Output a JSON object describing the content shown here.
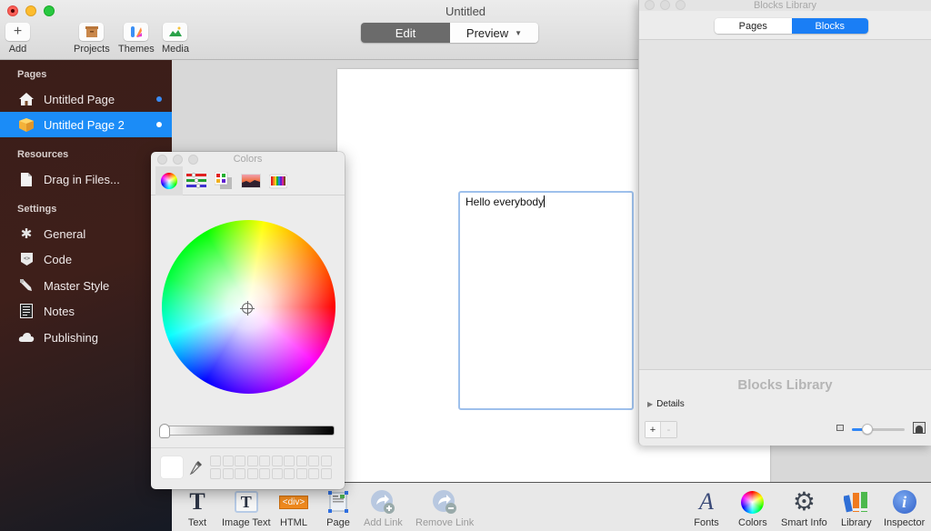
{
  "window": {
    "title": "Untitled"
  },
  "toolbar": {
    "add_label": "Add",
    "projects_label": "Projects",
    "themes_label": "Themes",
    "media_label": "Media",
    "mode": {
      "edit_label": "Edit",
      "preview_label": "Preview",
      "active": "Edit"
    }
  },
  "sidebar": {
    "sections": {
      "pages": "Pages",
      "resources": "Resources",
      "settings": "Settings"
    },
    "pages": [
      {
        "label": "Untitled Page",
        "icon": "home-icon",
        "selected": false
      },
      {
        "label": "Untitled Page 2",
        "icon": "box-icon",
        "selected": true
      }
    ],
    "resources": [
      {
        "label": "Drag in Files...",
        "icon": "file-icon"
      }
    ],
    "settings": [
      {
        "label": "General",
        "icon": "gear-icon"
      },
      {
        "label": "Code",
        "icon": "code-icon"
      },
      {
        "label": "Master Style",
        "icon": "eyedropper-icon"
      },
      {
        "label": "Notes",
        "icon": "notes-icon"
      },
      {
        "label": "Publishing",
        "icon": "cloud-icon"
      }
    ],
    "accent": "#1b8cf7"
  },
  "canvas": {
    "text_box_content": "Hello everybody"
  },
  "colors_panel": {
    "title": "Colors",
    "tabs": [
      "color-wheel",
      "color-sliders",
      "color-palettes",
      "image-palettes",
      "pencils"
    ],
    "active_tab": "color-wheel",
    "selected_color": "#ffffff",
    "brightness": 1.0
  },
  "blocks_panel": {
    "title": "Blocks Library",
    "tabs": {
      "pages": "Pages",
      "blocks": "Blocks"
    },
    "active_tab": "Blocks",
    "footer_title": "Blocks Library",
    "details_label": "Details",
    "add_label": "+",
    "remove_label": "-",
    "thumb_size": 0.3
  },
  "bottombar": {
    "left": [
      {
        "label": "Text",
        "enabled": true
      },
      {
        "label": "Image Text",
        "enabled": true
      },
      {
        "label": "HTML",
        "enabled": true,
        "badge": "<div>"
      },
      {
        "label": "Page",
        "enabled": true
      },
      {
        "label": "Add Link",
        "enabled": false
      },
      {
        "label": "Remove Link",
        "enabled": false
      }
    ],
    "right": [
      {
        "label": "Fonts"
      },
      {
        "label": "Colors"
      },
      {
        "label": "Smart Info"
      },
      {
        "label": "Library"
      },
      {
        "label": "Inspector"
      }
    ]
  }
}
